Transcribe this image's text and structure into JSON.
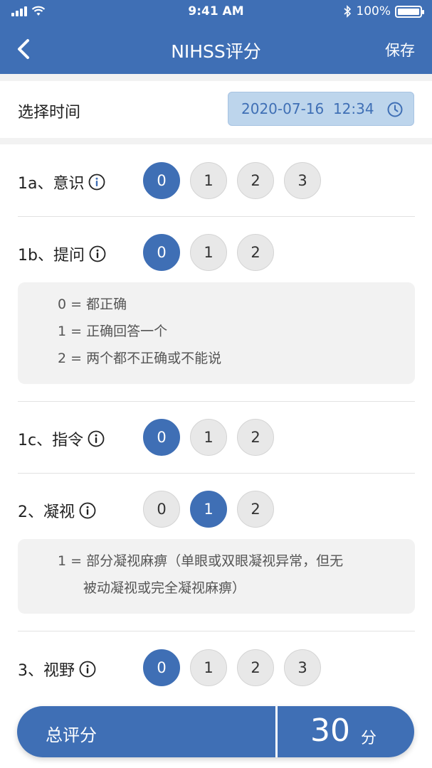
{
  "status_bar": {
    "time": "9:41 AM",
    "battery": "100%"
  },
  "nav": {
    "title": "NIHSS评分",
    "save_label": "保存"
  },
  "time_select": {
    "label": "选择时间",
    "value": "2020-07-16  12:34"
  },
  "items": [
    {
      "label": "1a、意识",
      "options": [
        "0",
        "1",
        "2",
        "3"
      ],
      "selected": "0"
    },
    {
      "label": "1b、提问",
      "options": [
        "0",
        "1",
        "2"
      ],
      "selected": "0",
      "note": [
        "0 = 都正确",
        "1 = 正确回答一个",
        "2 = 两个都不正确或不能说"
      ]
    },
    {
      "label": "1c、指令",
      "options": [
        "0",
        "1",
        "2"
      ],
      "selected": "0"
    },
    {
      "label": "2、凝视",
      "options": [
        "0",
        "1",
        "2"
      ],
      "selected": "1",
      "note": [
        "1 = 部分凝视麻痹（单眼或双眼凝视异常，但无",
        "被动凝视或完全凝视麻痹）"
      ]
    },
    {
      "label": "3、视野",
      "options": [
        "0",
        "1",
        "2",
        "3"
      ],
      "selected": "0"
    }
  ],
  "total": {
    "label": "总评分",
    "value": "30",
    "unit": "分"
  },
  "colors": {
    "primary": "#3f6fb5",
    "time_pill_bg": "#bdd5ec",
    "option_bg": "#e8e8e8",
    "note_bg": "#f2f2f2"
  },
  "icons": {
    "back": "chevron-left-icon",
    "clock": "clock-icon",
    "info": "info-icon",
    "bluetooth": "bluetooth-icon",
    "wifi": "wifi-icon",
    "signal": "signal-icon",
    "battery": "battery-icon"
  }
}
